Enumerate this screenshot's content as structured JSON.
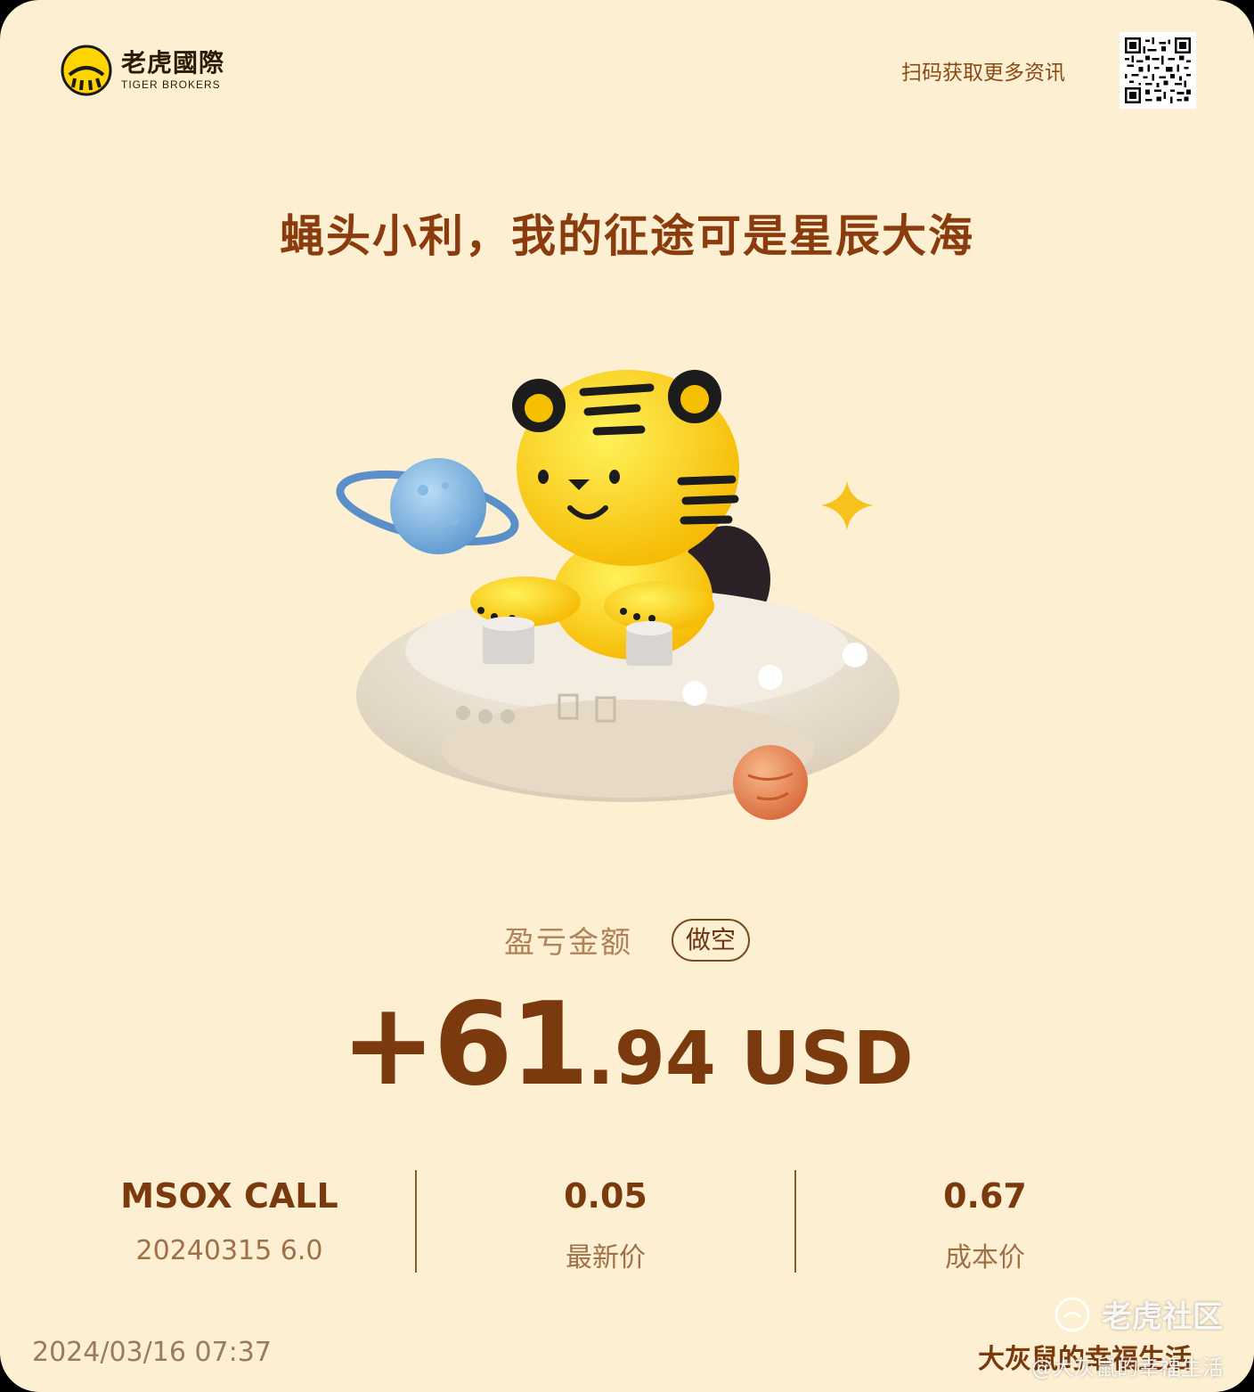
{
  "brand": {
    "name_cn": "老虎國際",
    "name_en": "TIGER BROKERS",
    "scan_text": "扫码获取更多资讯"
  },
  "headline": "蝇头小利，我的征途可是星辰大海",
  "pnl": {
    "label": "盈亏金额",
    "badge": "做空",
    "amount_integer": "+61",
    "amount_decimal": ".94",
    "currency": "USD"
  },
  "stats": {
    "contract_name": "MSOX CALL",
    "contract_detail": "20240315 6.0",
    "last_price": "0.05",
    "last_price_label": "最新价",
    "cost_price": "0.67",
    "cost_price_label": "成本价"
  },
  "footer": {
    "datetime": "2024/03/16 07:37",
    "username": "大灰鼠的幸福生活"
  },
  "watermark": {
    "brand": "老虎社区",
    "user": "@大灰鼠的幸福生活"
  },
  "colors": {
    "background": "#fdf0d2",
    "accent": "#8a3c0e",
    "tiger_yellow": "#ffd400"
  },
  "icons": [
    "tiger-logo-icon",
    "qr-code-icon",
    "tiger-ufo-illustration",
    "watermark-logo-icon"
  ]
}
